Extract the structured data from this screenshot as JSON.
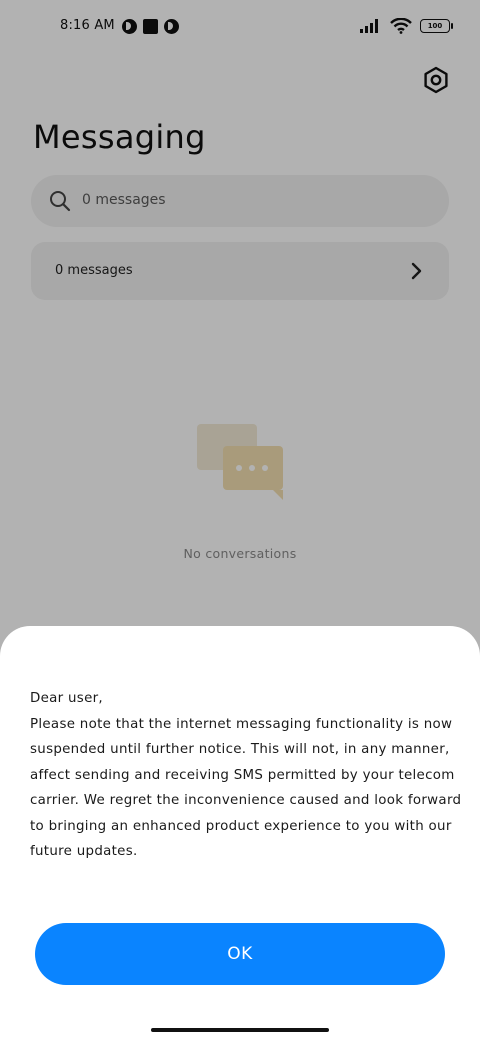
{
  "status_bar": {
    "time": "8:16 AM",
    "battery": "100"
  },
  "header": {
    "title": "Messaging",
    "settings_icon": "gear-icon"
  },
  "search": {
    "placeholder": "0 messages"
  },
  "messages_row": {
    "label": "0 messages"
  },
  "empty_state": {
    "text": "No conversations"
  },
  "dialog": {
    "greeting": "Dear user,",
    "body": "Please note that the internet messaging functionality is now suspended until further notice. This will not, in any manner, affect sending and receiving SMS permitted by your telecom carrier. We regret the inconvenience caused and look forward to bringing an enhanced product experience to you with our future updates.",
    "ok_label": "OK"
  },
  "colors": {
    "accent": "#0a84ff",
    "overlay": "#b3b3b3",
    "card": "#f1f1f1"
  }
}
